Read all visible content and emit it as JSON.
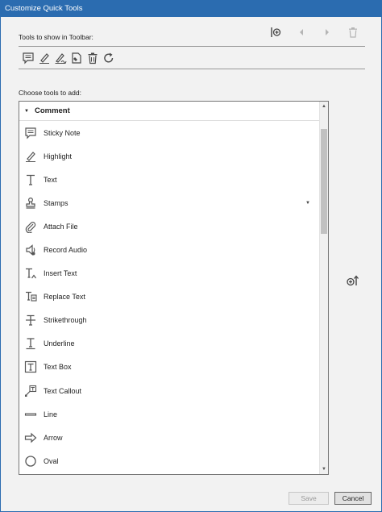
{
  "window": {
    "title": "Customize Quick Tools"
  },
  "toolbar_section": {
    "label": "Tools to show in Toolbar:",
    "actions": [
      {
        "name": "add-separator",
        "icon": "add-separator-icon"
      },
      {
        "name": "move-left",
        "icon": "arrow-left-icon"
      },
      {
        "name": "move-right",
        "icon": "arrow-right-icon"
      },
      {
        "name": "delete",
        "icon": "trash-icon"
      }
    ],
    "icons": [
      "sticky-note-icon",
      "highlight-icon",
      "sign-icon",
      "stamp-tool-icon",
      "trash-icon",
      "redo-icon"
    ]
  },
  "choose_section": {
    "label": "Choose tools to add:",
    "group": "Comment",
    "items": [
      {
        "label": "Sticky Note",
        "icon": "sticky-note-icon"
      },
      {
        "label": "Highlight",
        "icon": "highlight-icon"
      },
      {
        "label": "Text",
        "icon": "text-icon"
      },
      {
        "label": "Stamps",
        "icon": "stamp-icon",
        "dropdown": true
      },
      {
        "label": "Attach File",
        "icon": "attach-file-icon"
      },
      {
        "label": "Record Audio",
        "icon": "record-audio-icon"
      },
      {
        "label": "Insert Text",
        "icon": "insert-text-icon"
      },
      {
        "label": "Replace Text",
        "icon": "replace-text-icon"
      },
      {
        "label": "Strikethrough",
        "icon": "strikethrough-icon"
      },
      {
        "label": "Underline",
        "icon": "underline-icon"
      },
      {
        "label": "Text Box",
        "icon": "text-box-icon"
      },
      {
        "label": "Text Callout",
        "icon": "text-callout-icon"
      },
      {
        "label": "Line",
        "icon": "line-icon"
      },
      {
        "label": "Arrow",
        "icon": "arrow-icon"
      },
      {
        "label": "Oval",
        "icon": "oval-icon"
      }
    ]
  },
  "buttons": {
    "save": "Save",
    "cancel": "Cancel"
  },
  "colors": {
    "titlebar": "#2b6cb0",
    "background": "#f2f2f2",
    "icon": "#5a5a5a"
  }
}
